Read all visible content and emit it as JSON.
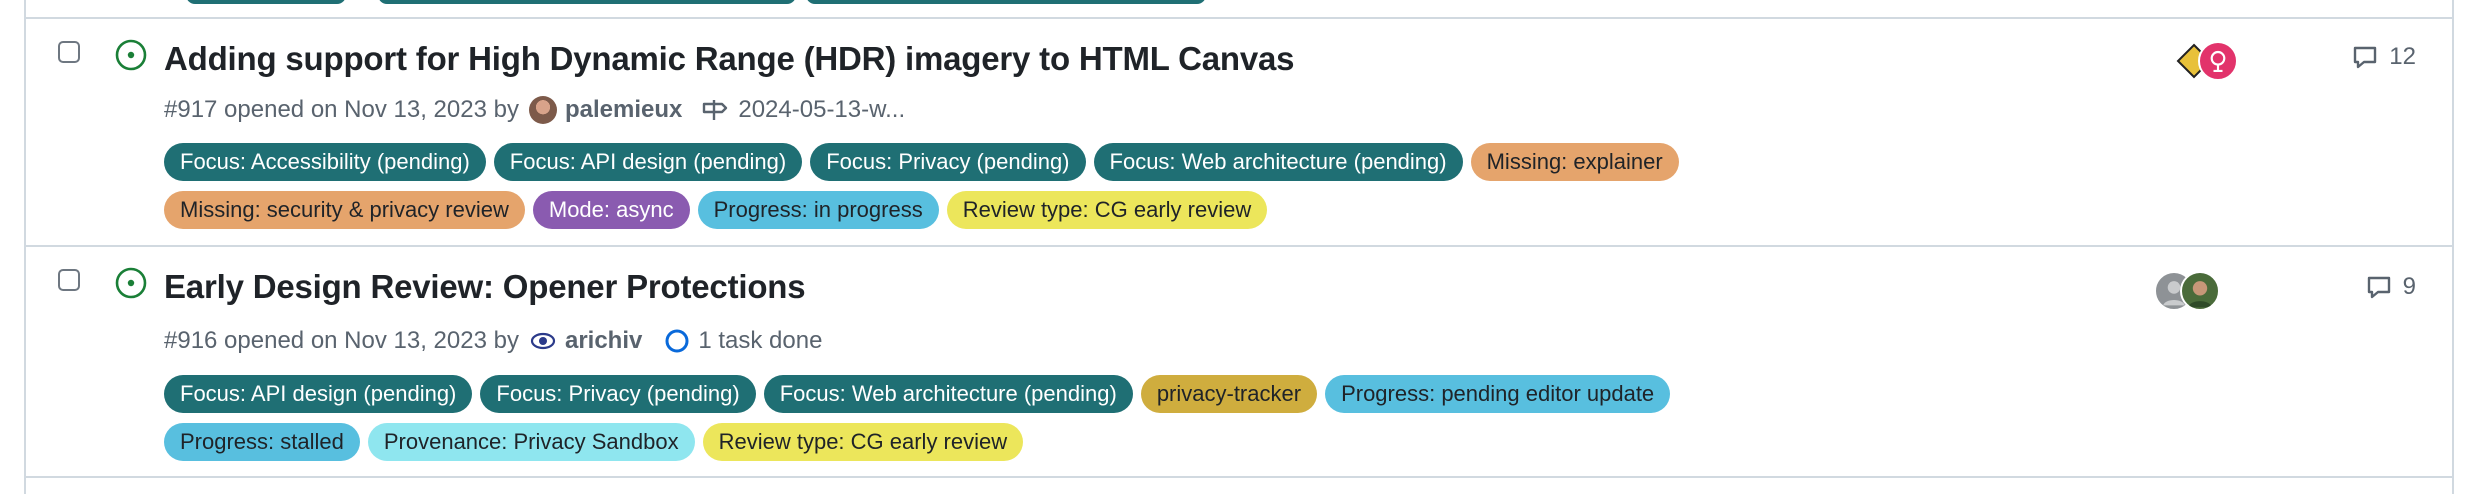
{
  "issues": [
    {
      "title": "Adding support for High Dynamic Range (HDR) imagery to HTML Canvas",
      "meta_prefix": "#917 opened on Nov 13, 2023 by",
      "author": "palemieux",
      "milestone": "2024-05-13-w...",
      "comment_count": "12",
      "labels": [
        {
          "text": "Focus: Accessibility (pending)",
          "color": "#1f6f74"
        },
        {
          "text": "Focus: API design (pending)",
          "color": "#1f6f74"
        },
        {
          "text": "Focus: Privacy (pending)",
          "color": "#1f6f74"
        },
        {
          "text": "Focus: Web architecture (pending)",
          "color": "#1f6f74"
        },
        {
          "text": "Missing: explainer",
          "color": "#e5a46c"
        },
        {
          "text": "Missing: security & privacy review",
          "color": "#e5a46c"
        },
        {
          "text": "Mode: async",
          "color": "#8a5bb0"
        },
        {
          "text": "Progress: in progress",
          "color": "#58bfdf"
        },
        {
          "text": "Review type: CG early review",
          "color": "#ece65b"
        }
      ]
    },
    {
      "title": "Early Design Review: Opener Protections",
      "meta_prefix": "#916 opened on Nov 13, 2023 by",
      "author": "arichiv",
      "tasks": "1 task done",
      "comment_count": "9",
      "labels": [
        {
          "text": "Focus: API design (pending)",
          "color": "#1f6f74"
        },
        {
          "text": "Focus: Privacy (pending)",
          "color": "#1f6f74"
        },
        {
          "text": "Focus: Web architecture (pending)",
          "color": "#1f6f74"
        },
        {
          "text": "privacy-tracker",
          "color": "#cfad3e"
        },
        {
          "text": "Progress: pending editor update",
          "color": "#58bfdf"
        },
        {
          "text": "Progress: stalled",
          "color": "#58bfdf"
        },
        {
          "text": "Provenance: Privacy Sandbox",
          "color": "#8fe6ef"
        },
        {
          "text": "Review type: CG early review",
          "color": "#ece65b"
        }
      ]
    }
  ],
  "icons": {
    "open_issue": "issue-opened-icon",
    "milestone": "milestone-icon",
    "tasks": "task-progress-icon",
    "comment": "comment-icon"
  }
}
